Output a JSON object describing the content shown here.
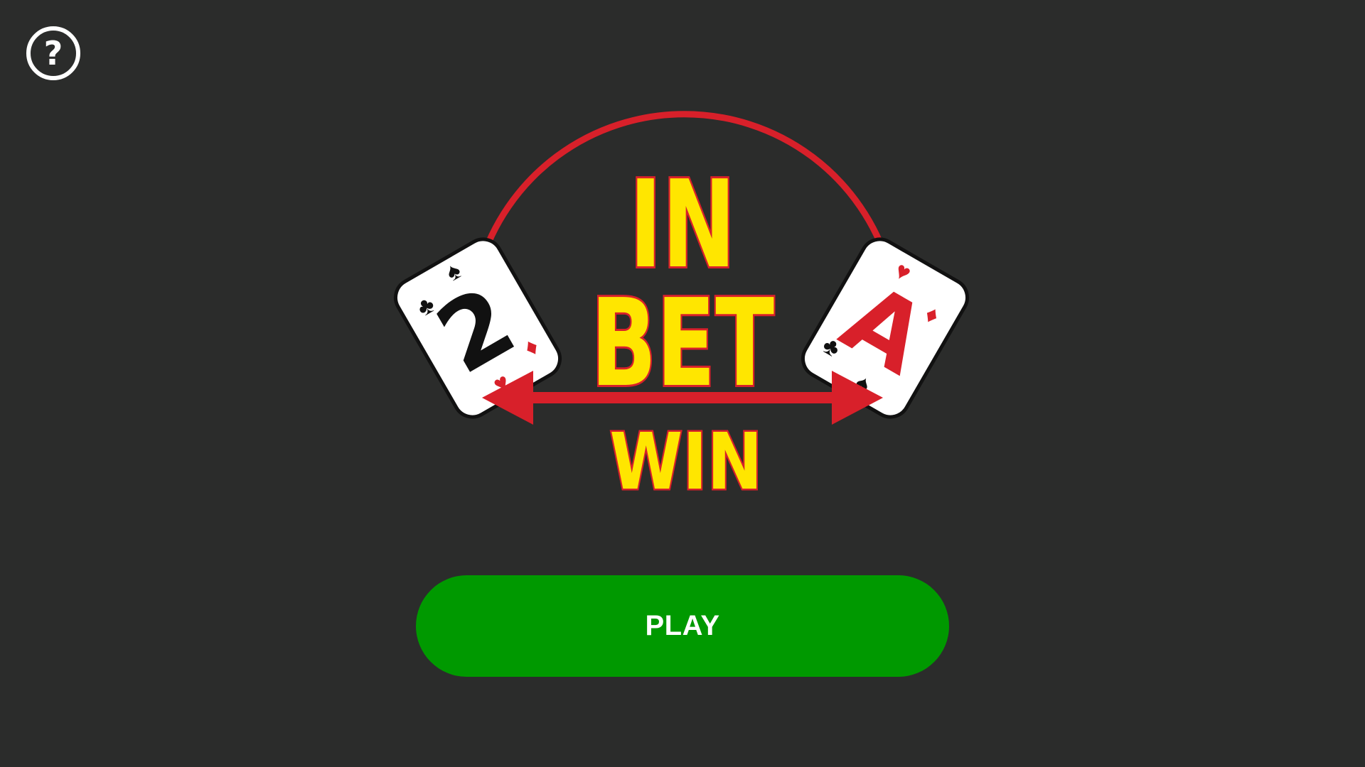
{
  "colors": {
    "background": "#2b2c2b",
    "play_button": "#009900",
    "play_text": "#ffffff",
    "logo_yellow": "#ffe600",
    "logo_red": "#d8202a",
    "card_white": "#ffffff",
    "card_black": "#111111"
  },
  "help": {
    "icon": "question-circle-icon",
    "glyph": "?"
  },
  "logo": {
    "line1": "IN",
    "line2": "BET",
    "line3": "WIN",
    "left_card": {
      "rank": "2",
      "suits": [
        "spade-icon",
        "club-icon",
        "heart-icon",
        "diamond-icon"
      ]
    },
    "right_card": {
      "rank": "A",
      "suits": [
        "heart-icon",
        "diamond-icon",
        "club-icon",
        "spade-icon"
      ]
    }
  },
  "play_button": {
    "label": "PLAY"
  }
}
